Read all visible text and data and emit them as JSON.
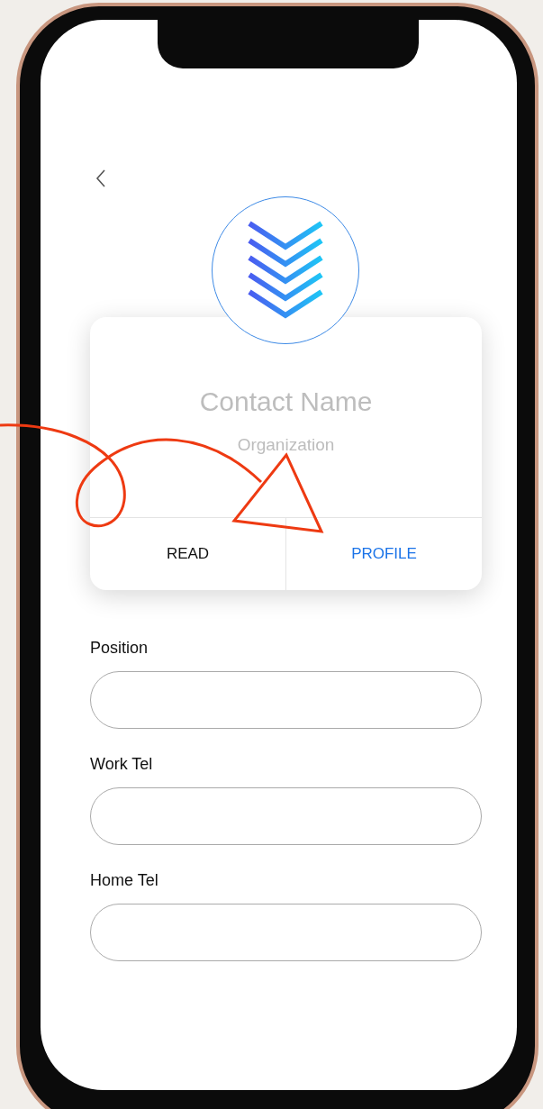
{
  "contact": {
    "name": "Contact Name",
    "organization": "Organization"
  },
  "tabs": [
    {
      "label": "READ",
      "selected": false
    },
    {
      "label": "PROFILE",
      "selected": true
    }
  ],
  "fields": [
    {
      "label": "Position"
    },
    {
      "label": "Work Tel"
    },
    {
      "label": "Home Tel"
    }
  ]
}
